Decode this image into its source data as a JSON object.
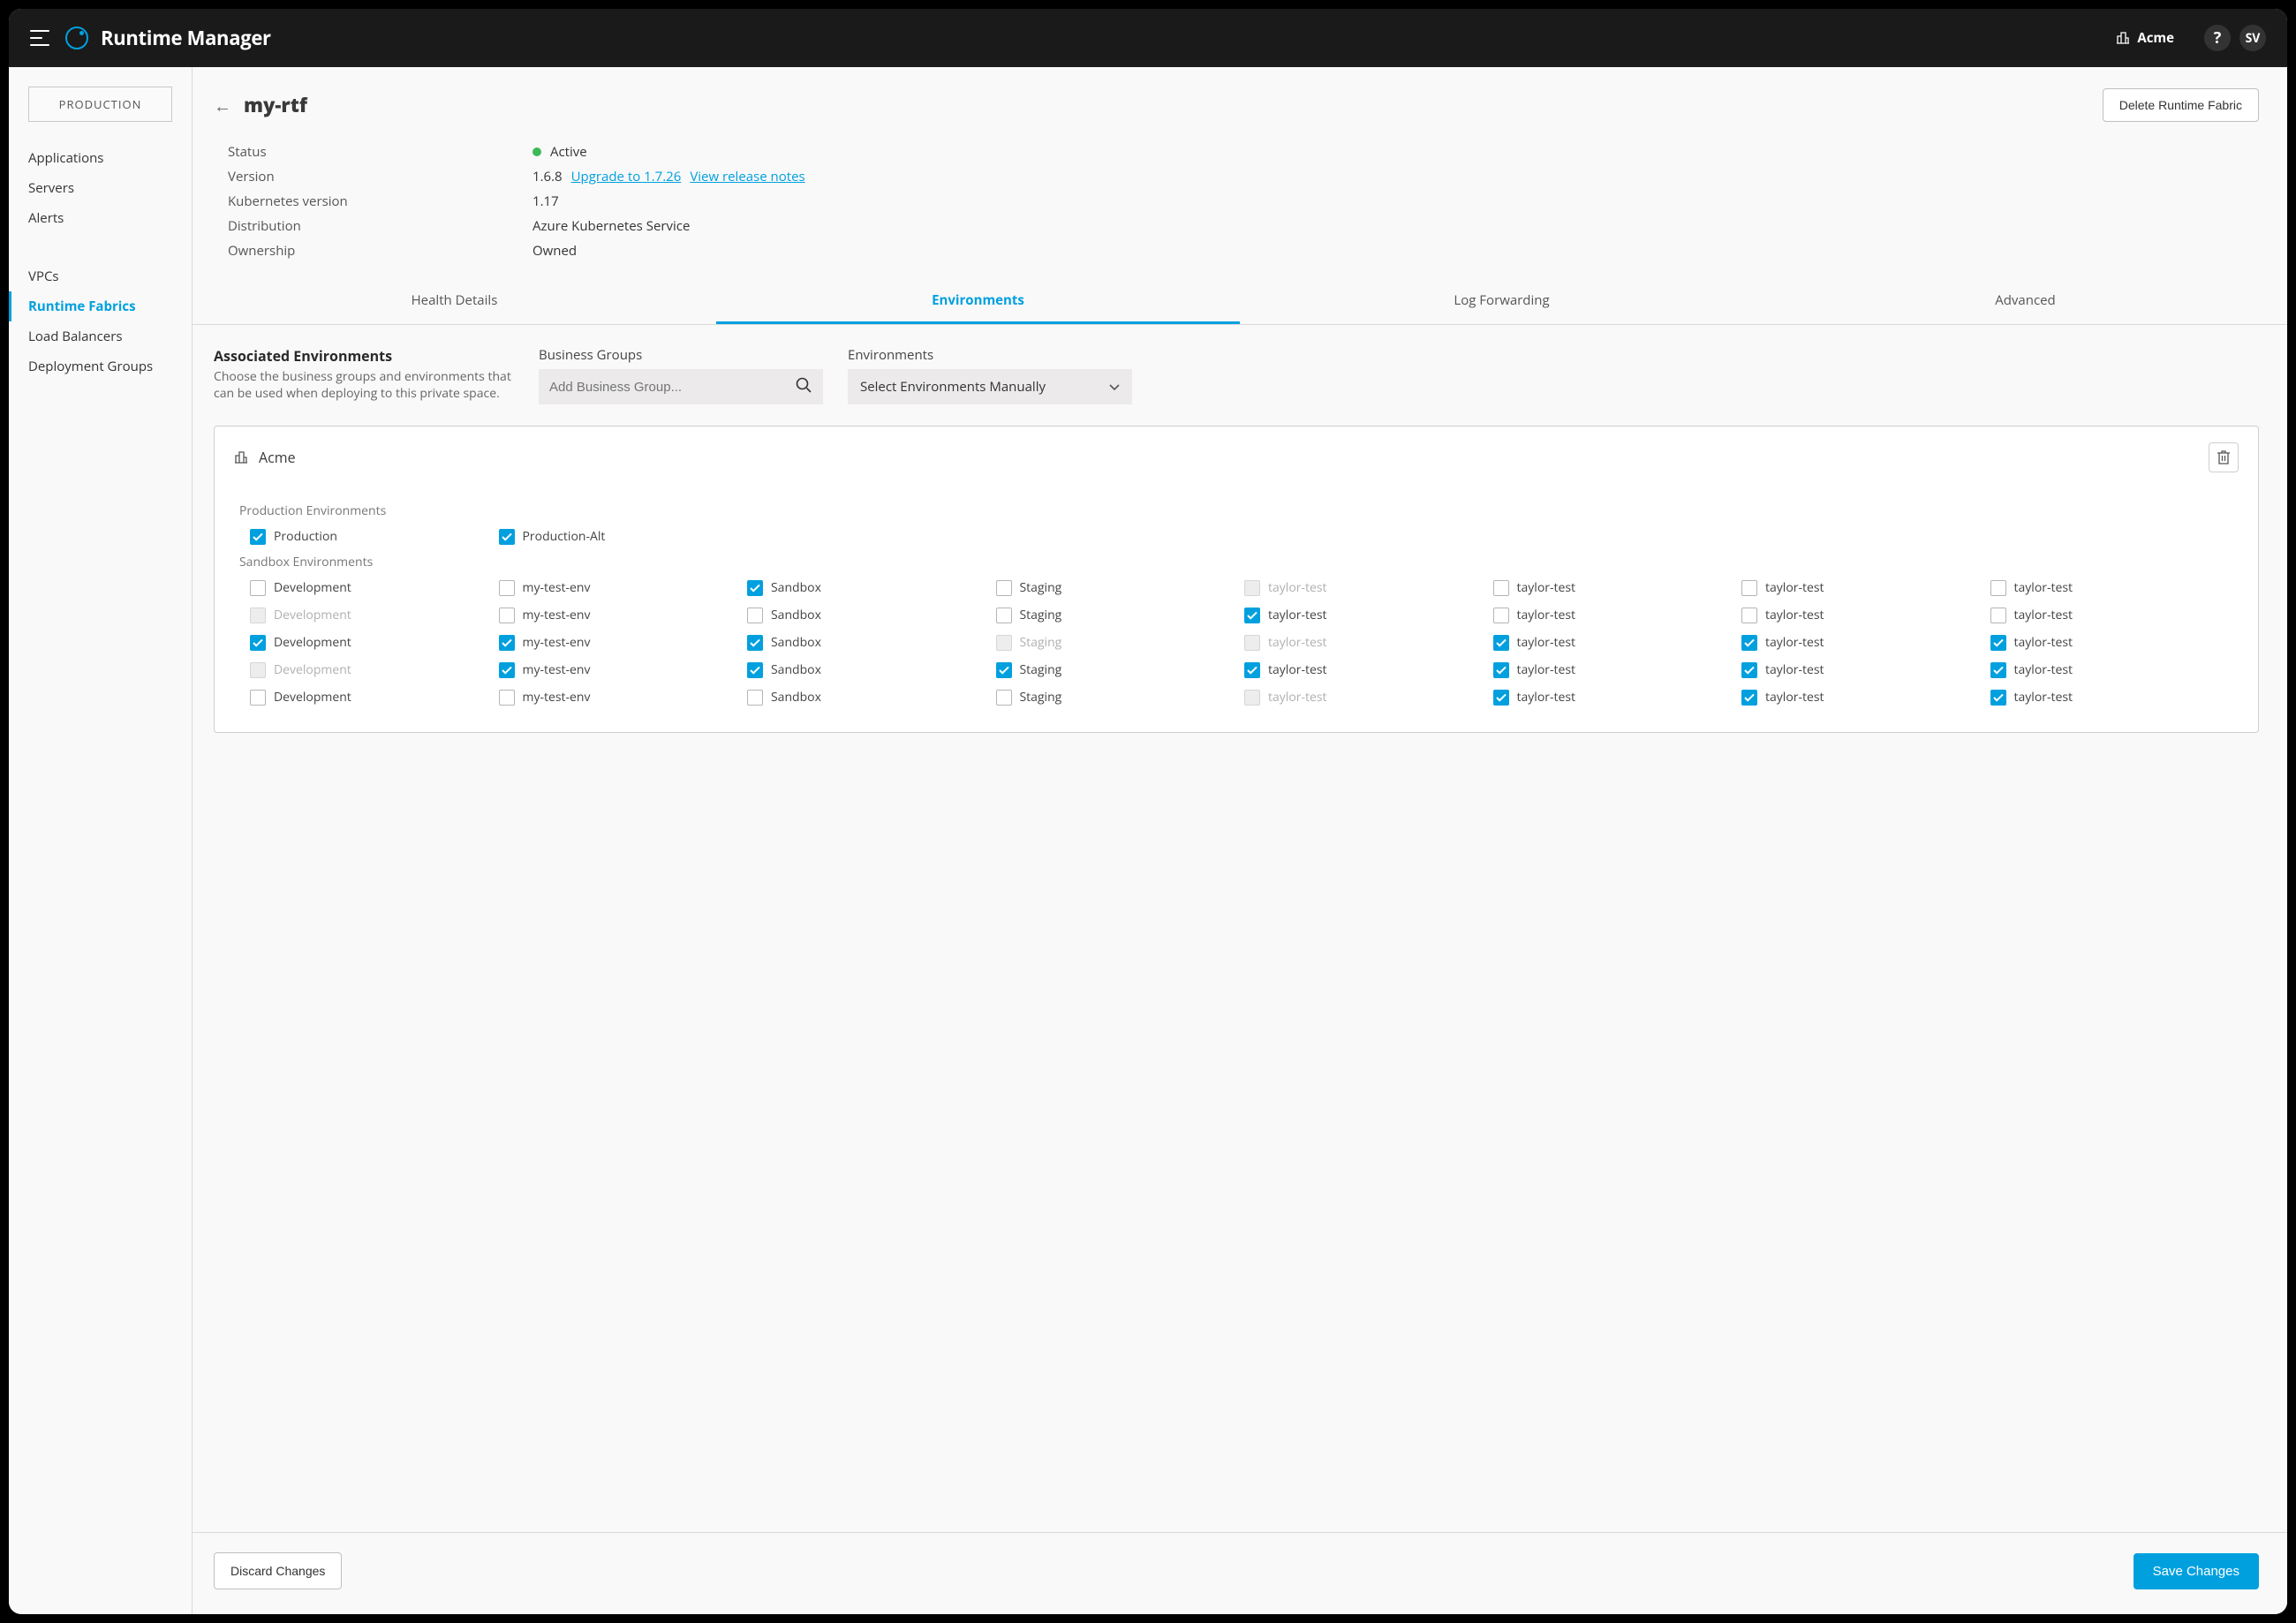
{
  "app": {
    "title": "Runtime Manager"
  },
  "topbar": {
    "org": "Acme",
    "user_initials": "SV",
    "help": "?"
  },
  "sidebar": {
    "env_button": "PRODUCTION",
    "group1": [
      "Applications",
      "Servers",
      "Alerts"
    ],
    "group2": [
      "VPCs",
      "Runtime Fabrics",
      "Load Balancers",
      "Deployment Groups"
    ],
    "active": "Runtime Fabrics"
  },
  "page": {
    "title": "my-rtf",
    "delete_label": "Delete Runtime Fabric"
  },
  "info": {
    "rows": [
      {
        "label": "Status",
        "type": "status",
        "value": "Active"
      },
      {
        "label": "Version",
        "type": "version",
        "value": "1.6.8",
        "upgrade": "Upgrade to 1.7.26",
        "notes": "View release notes"
      },
      {
        "label": "Kubernetes version",
        "type": "text",
        "value": "1.17"
      },
      {
        "label": "Distribution",
        "type": "text",
        "value": "Azure Kubernetes Service"
      },
      {
        "label": "Ownership",
        "type": "text",
        "value": "Owned"
      }
    ]
  },
  "tabs": {
    "items": [
      "Health Details",
      "Environments",
      "Log Forwarding",
      "Advanced"
    ],
    "active": "Environments"
  },
  "assoc": {
    "title": "Associated Environments",
    "desc": "Choose the business groups and environments that can be used when deploying to this private space.",
    "bg_label": "Business Groups",
    "bg_placeholder": "Add Business Group...",
    "env_label": "Environments",
    "env_select": "Select Environments Manually"
  },
  "card": {
    "org": "Acme",
    "prod_label": "Production Environments",
    "sandbox_label": "Sandbox Environments",
    "prod": [
      {
        "label": "Production",
        "checked": true,
        "disabled": false
      },
      {
        "label": "Production-Alt",
        "checked": true,
        "disabled": false
      }
    ],
    "sandbox": [
      [
        {
          "label": "Development",
          "checked": false,
          "disabled": false
        },
        {
          "label": "my-test-env",
          "checked": false,
          "disabled": false
        },
        {
          "label": "Sandbox",
          "checked": true,
          "disabled": false
        },
        {
          "label": "Staging",
          "checked": false,
          "disabled": false
        },
        {
          "label": "taylor-test",
          "checked": false,
          "disabled": true
        },
        {
          "label": "taylor-test",
          "checked": false,
          "disabled": false
        },
        {
          "label": "taylor-test",
          "checked": false,
          "disabled": false
        },
        {
          "label": "taylor-test",
          "checked": false,
          "disabled": false
        }
      ],
      [
        {
          "label": "Development",
          "checked": false,
          "disabled": true
        },
        {
          "label": "my-test-env",
          "checked": false,
          "disabled": false
        },
        {
          "label": "Sandbox",
          "checked": false,
          "disabled": false
        },
        {
          "label": "Staging",
          "checked": false,
          "disabled": false
        },
        {
          "label": "taylor-test",
          "checked": true,
          "disabled": false
        },
        {
          "label": "taylor-test",
          "checked": false,
          "disabled": false
        },
        {
          "label": "taylor-test",
          "checked": false,
          "disabled": false
        },
        {
          "label": "taylor-test",
          "checked": false,
          "disabled": false
        }
      ],
      [
        {
          "label": "Development",
          "checked": true,
          "disabled": false
        },
        {
          "label": "my-test-env",
          "checked": true,
          "disabled": false
        },
        {
          "label": "Sandbox",
          "checked": true,
          "disabled": false
        },
        {
          "label": "Staging",
          "checked": false,
          "disabled": true
        },
        {
          "label": "taylor-test",
          "checked": false,
          "disabled": true
        },
        {
          "label": "taylor-test",
          "checked": true,
          "disabled": false
        },
        {
          "label": "taylor-test",
          "checked": true,
          "disabled": false
        },
        {
          "label": "taylor-test",
          "checked": true,
          "disabled": false
        }
      ],
      [
        {
          "label": "Development",
          "checked": false,
          "disabled": true
        },
        {
          "label": "my-test-env",
          "checked": true,
          "disabled": false
        },
        {
          "label": "Sandbox",
          "checked": true,
          "disabled": false
        },
        {
          "label": "Staging",
          "checked": true,
          "disabled": false
        },
        {
          "label": "taylor-test",
          "checked": true,
          "disabled": false
        },
        {
          "label": "taylor-test",
          "checked": true,
          "disabled": false
        },
        {
          "label": "taylor-test",
          "checked": true,
          "disabled": false
        },
        {
          "label": "taylor-test",
          "checked": true,
          "disabled": false
        }
      ],
      [
        {
          "label": "Development",
          "checked": false,
          "disabled": false
        },
        {
          "label": "my-test-env",
          "checked": false,
          "disabled": false
        },
        {
          "label": "Sandbox",
          "checked": false,
          "disabled": false
        },
        {
          "label": "Staging",
          "checked": false,
          "disabled": false
        },
        {
          "label": "taylor-test",
          "checked": false,
          "disabled": true
        },
        {
          "label": "taylor-test",
          "checked": true,
          "disabled": false
        },
        {
          "label": "taylor-test",
          "checked": true,
          "disabled": false
        },
        {
          "label": "taylor-test",
          "checked": true,
          "disabled": false
        }
      ]
    ]
  },
  "footer": {
    "discard": "Discard Changes",
    "save": "Save Changes"
  }
}
